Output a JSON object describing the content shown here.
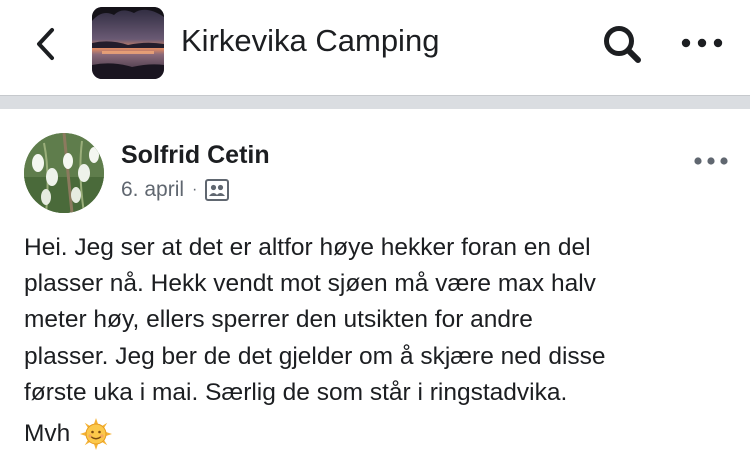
{
  "header": {
    "title": "Kirkevika Camping",
    "back_icon": "chevron-left-icon",
    "search_icon": "search-icon",
    "more_icon": "more-horizontal-icon"
  },
  "post": {
    "author": "Solfrid Cetin",
    "date": "6. april",
    "separator": "·",
    "audience_icon": "group-audience-icon",
    "more_icon": "more-horizontal-icon",
    "text": "Hei. Jeg ser at det er altfor høye hekker foran en del\nplasser nå. Hekk vendt mot sjøen må være max halv\nmeter høy, ellers sperrer den utsikten for andre\nplasser. Jeg ber de det gjelder om å skjære ned disse\nførste uka i mai. Særlig de som står i ringstadvika.",
    "signoff": "Mvh",
    "signoff_emoji": "sun-face-emoji"
  },
  "colors": {
    "text": "#1c1e21",
    "meta": "#606770",
    "divider": "#dadde1",
    "background": "#ffffff"
  }
}
